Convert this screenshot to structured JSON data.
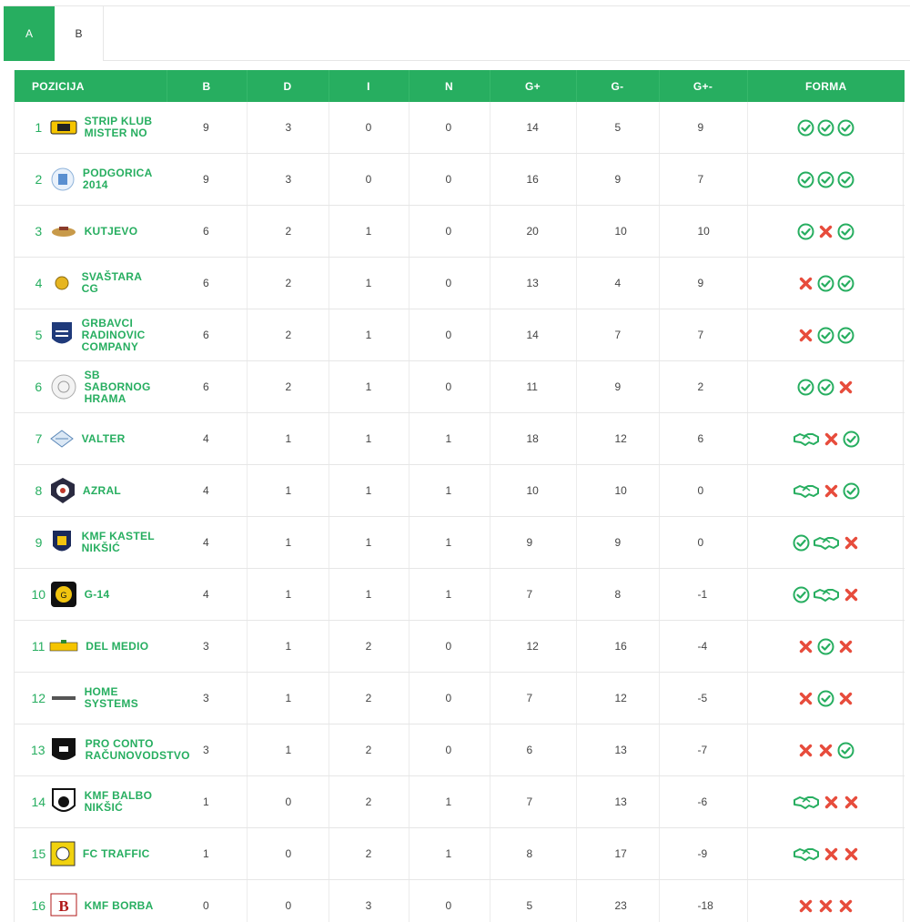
{
  "tabs": [
    {
      "label": "A",
      "active": true
    },
    {
      "label": "B",
      "active": false
    }
  ],
  "headers": {
    "pos": "POZICIJA",
    "w": "B",
    "d": "D",
    "l": "I",
    "n": "N",
    "gf": "G+",
    "ga": "G-",
    "gd": "G+-",
    "form": "FORMA"
  },
  "colors": {
    "accent": "#27ae60",
    "win": "#27ae60",
    "loss": "#e74c3c",
    "draw": "#27ae60"
  },
  "rows": [
    {
      "rank": "1",
      "team": "STRIP KLUB\nMISTER NO",
      "logo": "yellow-badge-logo",
      "w": "9",
      "d": "3",
      "l": "0",
      "n": "0",
      "gf": "14",
      "ga": "5",
      "gd": "9",
      "form": [
        "win",
        "win",
        "win"
      ]
    },
    {
      "rank": "2",
      "team": "PODGORICA\n2014",
      "logo": "crest-logo",
      "w": "9",
      "d": "3",
      "l": "0",
      "n": "0",
      "gf": "16",
      "ga": "9",
      "gd": "7",
      "form": [
        "win",
        "win",
        "win"
      ]
    },
    {
      "rank": "3",
      "team": "KUTJEVO",
      "logo": "wine-logo",
      "w": "6",
      "d": "2",
      "l": "1",
      "n": "0",
      "gf": "20",
      "ga": "10",
      "gd": "10",
      "form": [
        "win",
        "loss",
        "win"
      ]
    },
    {
      "rank": "4",
      "team": "SVAŠTARA\nCG",
      "logo": "coin-logo",
      "w": "6",
      "d": "2",
      "l": "1",
      "n": "0",
      "gf": "13",
      "ga": "4",
      "gd": "9",
      "form": [
        "loss",
        "win",
        "win"
      ]
    },
    {
      "rank": "5",
      "team": "GRBAVCI\nRADINOVIC\nCOMPANY",
      "logo": "shield-logo",
      "w": "6",
      "d": "2",
      "l": "1",
      "n": "0",
      "gf": "14",
      "ga": "7",
      "gd": "7",
      "form": [
        "loss",
        "win",
        "win"
      ]
    },
    {
      "rank": "6",
      "team": "SB\nSABORNOG\nHRAMA",
      "logo": "round-seal-logo",
      "w": "6",
      "d": "2",
      "l": "1",
      "n": "0",
      "gf": "11",
      "ga": "9",
      "gd": "2",
      "form": [
        "win",
        "win",
        "loss"
      ]
    },
    {
      "rank": "7",
      "team": "VALTER",
      "logo": "diamond-logo",
      "w": "4",
      "d": "1",
      "l": "1",
      "n": "1",
      "gf": "18",
      "ga": "12",
      "gd": "6",
      "form": [
        "draw",
        "loss",
        "win"
      ]
    },
    {
      "rank": "8",
      "team": "AZRAL",
      "logo": "star-badge-logo",
      "w": "4",
      "d": "1",
      "l": "1",
      "n": "1",
      "gf": "10",
      "ga": "10",
      "gd": "0",
      "form": [
        "draw",
        "loss",
        "win"
      ]
    },
    {
      "rank": "9",
      "team": "KMF KASTEL\nNIKŠIĆ",
      "logo": "castle-shield-logo",
      "w": "4",
      "d": "1",
      "l": "1",
      "n": "1",
      "gf": "9",
      "ga": "9",
      "gd": "0",
      "form": [
        "win",
        "draw",
        "loss"
      ]
    },
    {
      "rank": "10",
      "team": "G-14",
      "logo": "black-badge-logo",
      "w": "4",
      "d": "1",
      "l": "1",
      "n": "1",
      "gf": "7",
      "ga": "8",
      "gd": "-1",
      "form": [
        "win",
        "draw",
        "loss"
      ]
    },
    {
      "rank": "11",
      "team": "DEL MEDIO",
      "logo": "banner-logo",
      "w": "3",
      "d": "1",
      "l": "2",
      "n": "0",
      "gf": "12",
      "ga": "16",
      "gd": "-4",
      "form": [
        "loss",
        "win",
        "loss"
      ]
    },
    {
      "rank": "12",
      "team": "HOME\nSYSTEMS",
      "logo": "wordmark-logo",
      "w": "3",
      "d": "1",
      "l": "2",
      "n": "0",
      "gf": "7",
      "ga": "12",
      "gd": "-5",
      "form": [
        "loss",
        "win",
        "loss"
      ]
    },
    {
      "rank": "13",
      "team": "PRO CONTO\nRAČUNOVODSTVO",
      "logo": "black-crest-logo",
      "w": "3",
      "d": "1",
      "l": "2",
      "n": "0",
      "gf": "6",
      "ga": "13",
      "gd": "-7",
      "form": [
        "loss",
        "loss",
        "win"
      ]
    },
    {
      "rank": "14",
      "team": "KMF BALBO\nNIKŠIĆ",
      "logo": "ball-shield-logo",
      "w": "1",
      "d": "0",
      "l": "2",
      "n": "1",
      "gf": "7",
      "ga": "13",
      "gd": "-6",
      "form": [
        "draw",
        "loss",
        "loss"
      ]
    },
    {
      "rank": "15",
      "team": "FC TRAFFIC",
      "logo": "yellow-square-logo",
      "w": "1",
      "d": "0",
      "l": "2",
      "n": "1",
      "gf": "8",
      "ga": "17",
      "gd": "-9",
      "form": [
        "draw",
        "loss",
        "loss"
      ]
    },
    {
      "rank": "16",
      "team": "KMF BORBA",
      "logo": "red-b-logo",
      "w": "0",
      "d": "0",
      "l": "3",
      "n": "0",
      "gf": "5",
      "ga": "23",
      "gd": "-18",
      "form": [
        "loss",
        "loss",
        "loss"
      ]
    }
  ]
}
